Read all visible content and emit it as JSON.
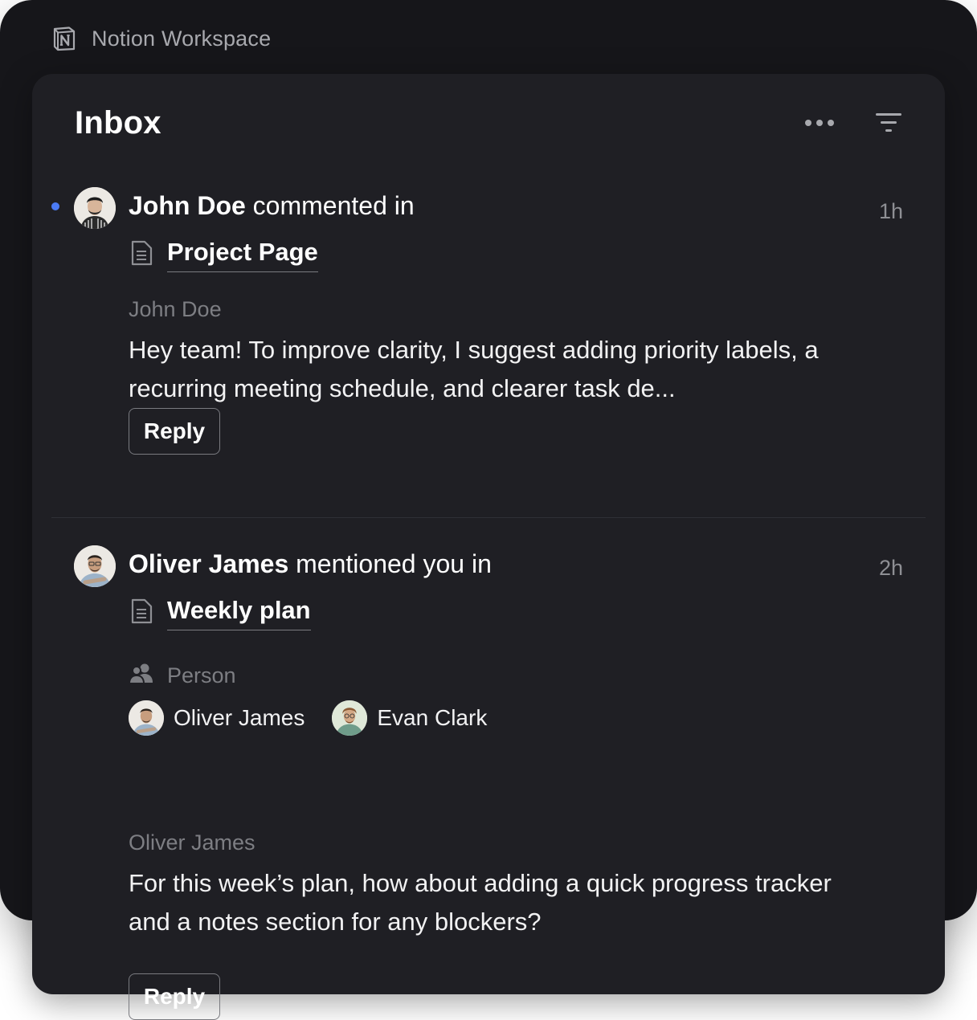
{
  "window": {
    "title": "Notion Workspace"
  },
  "inbox": {
    "title": "Inbox",
    "more_icon": "more-horizontal-icon",
    "filter_icon": "filter-icon"
  },
  "notifications": [
    {
      "unread": true,
      "actor": "John Doe",
      "action": " commented in",
      "time": "1h",
      "page_title": "Project Page",
      "author": "John Doe",
      "text": "Hey team! To improve clarity, I suggest adding priority labels, a recurring meeting schedule, and clearer task de...",
      "reply_label": "Reply"
    },
    {
      "unread": false,
      "actor": "Oliver James",
      "action": " mentioned you in",
      "time": "2h",
      "page_title": "Weekly plan",
      "property_label": "Person",
      "people": [
        "Oliver James",
        "Evan Clark"
      ],
      "author": "Oliver James",
      "text": "For this week’s plan, how about adding a quick progress tracker and a notes section for any blockers?",
      "reply_label": "Reply"
    }
  ],
  "colors": {
    "unread_dot": "#4b7bf5",
    "panel_bg": "#1f1f24",
    "window_bg": "#16161a"
  }
}
